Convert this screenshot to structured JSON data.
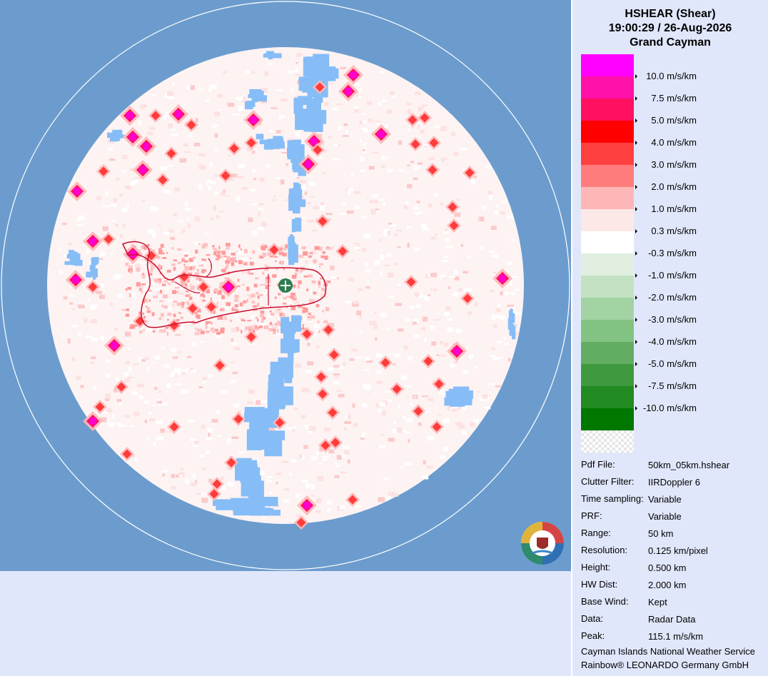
{
  "header": {
    "title": "HSHEAR (Shear)",
    "datetime": "19:00:29 / 26-Aug-2026",
    "station": "Grand Cayman"
  },
  "colors": {
    "background": "#6b9ccd",
    "panel": "#e1e7fb",
    "coastline": "#c8102e",
    "site_marker": "#2e7d4f"
  },
  "legend": {
    "swatches": [
      "#ff00ff",
      "#ff10a8",
      "#ff1060",
      "#ff0000",
      "#ff4040",
      "#ff7c7c",
      "#ffb6b6",
      "#fde8e8",
      "#ffffff",
      "#e0efe0",
      "#c3e2c3",
      "#a3d3a3",
      "#82c282",
      "#62ad62",
      "#3f993f",
      "#218a21",
      "#007800"
    ],
    "labels": [
      "10.0 m/s/km",
      "7.5 m/s/km",
      "5.0 m/s/km",
      "4.0 m/s/km",
      "3.0 m/s/km",
      "2.0 m/s/km",
      "1.0 m/s/km",
      "0.3 m/s/km",
      "-0.3 m/s/km",
      "-1.0 m/s/km",
      "-2.0 m/s/km",
      "-3.0 m/s/km",
      "-4.0 m/s/km",
      "-5.0 m/s/km",
      "-7.5 m/s/km",
      "-10.0 m/s/km"
    ]
  },
  "info": [
    {
      "key": "Pdf File:",
      "value": "50km_05km.hshear"
    },
    {
      "key": "Clutter Filter:",
      "value": "IIRDoppler 6"
    },
    {
      "key": "Time sampling:",
      "value": "Variable"
    },
    {
      "key": "PRF:",
      "value": "Variable"
    },
    {
      "key": "Range:",
      "value": "50 km"
    },
    {
      "key": "Resolution:",
      "value": "0.125 km/pixel"
    },
    {
      "key": "Height:",
      "value": "0.500 km"
    },
    {
      "key": "HW Dist:",
      "value": "2.000 km"
    },
    {
      "key": "Base Wind:",
      "value": "Kept"
    },
    {
      "key": "Data:",
      "value": "Radar Data"
    },
    {
      "key": "Peak:",
      "value": "115.1 m/s/km"
    }
  ],
  "footer": {
    "line1": "Cayman Islands National Weather Service",
    "line2": "Rainbow® LEONARDO Germany GmbH"
  }
}
